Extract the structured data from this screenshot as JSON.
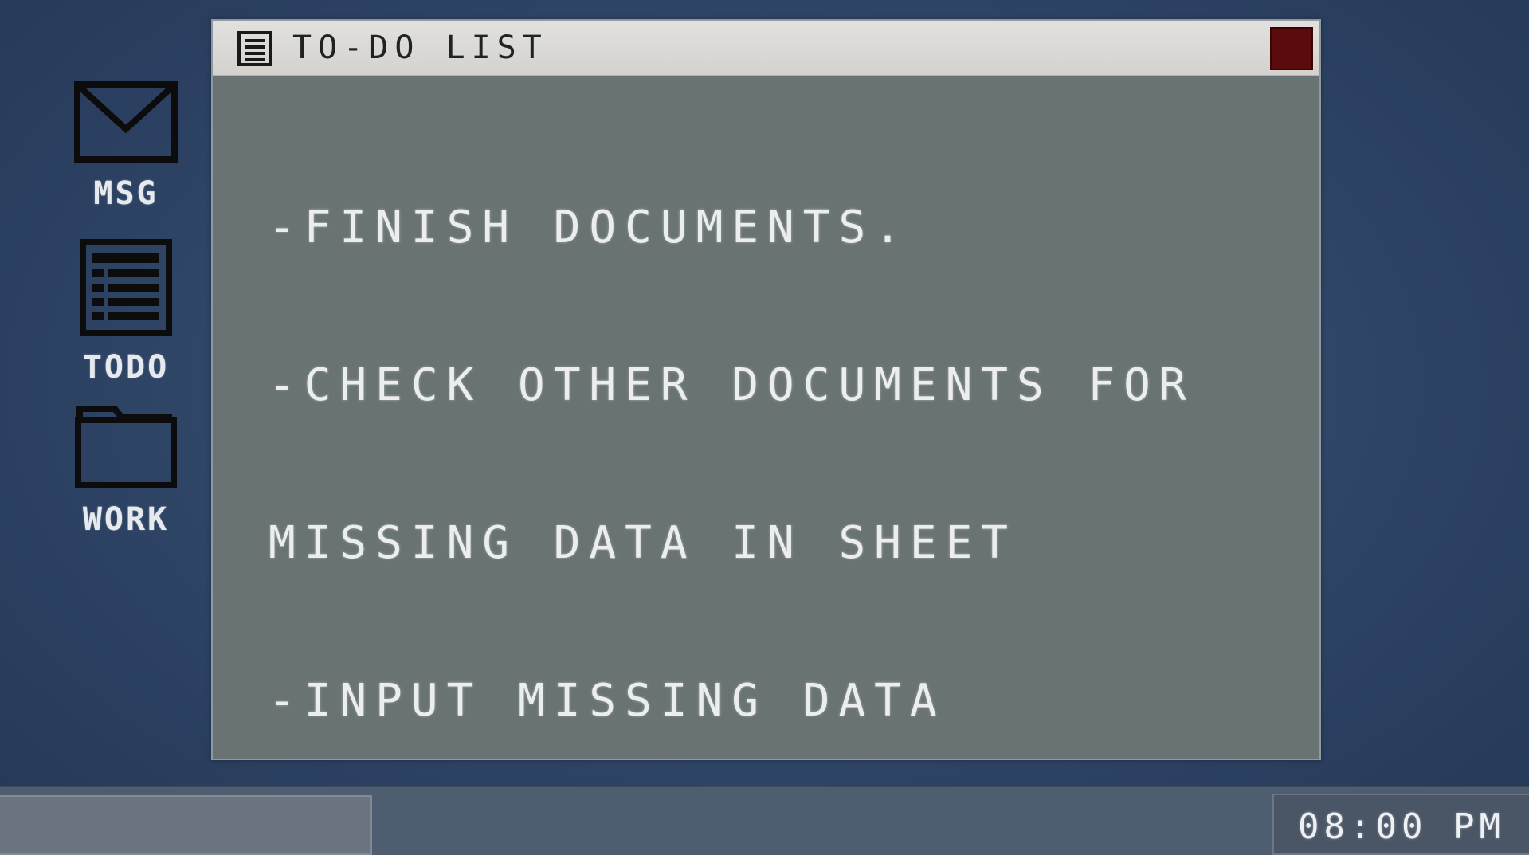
{
  "desktop": {
    "icons": [
      {
        "label": "MSG",
        "icon": "envelope-icon"
      },
      {
        "label": "TODO",
        "icon": "list-icon"
      },
      {
        "label": "WORK",
        "icon": "folder-icon"
      }
    ]
  },
  "window": {
    "title": "TO-DO LIST",
    "title_icon": "document-icon",
    "close_color": "#5b0b0c",
    "lines": [
      "-FINISH DOCUMENTS.",
      "-CHECK OTHER DOCUMENTS FOR",
      "MISSING DATA IN SHEET",
      "-INPUT MISSING DATA"
    ]
  },
  "taskbar": {
    "clock": "08:00 PM"
  },
  "colors": {
    "desktop_bg": "#2f4566",
    "window_bg": "#6a7374",
    "titlebar_bg": "#e2e1de"
  }
}
